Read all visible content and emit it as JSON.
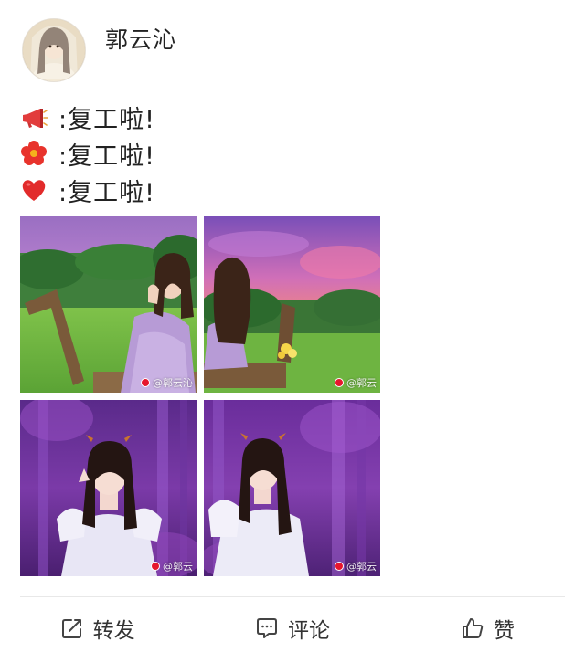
{
  "user": {
    "name": "郭云沁"
  },
  "lines": [
    {
      "icon": "megaphone-icon",
      "text": ":复工啦!"
    },
    {
      "icon": "flower-icon",
      "text": ":复工啦!"
    },
    {
      "icon": "heart-icon",
      "text": ":复工啦!"
    }
  ],
  "photos": [
    {
      "watermark": "@郭云沁"
    },
    {
      "watermark": "@郭云"
    },
    {
      "watermark": "@郭云"
    },
    {
      "watermark": "@郭云"
    }
  ],
  "actions": {
    "repost": "转发",
    "comment": "评论",
    "like": "赞"
  },
  "colors": {
    "accent_red": "#e6162d",
    "text": "#222222",
    "divider": "#e8e8e8"
  }
}
